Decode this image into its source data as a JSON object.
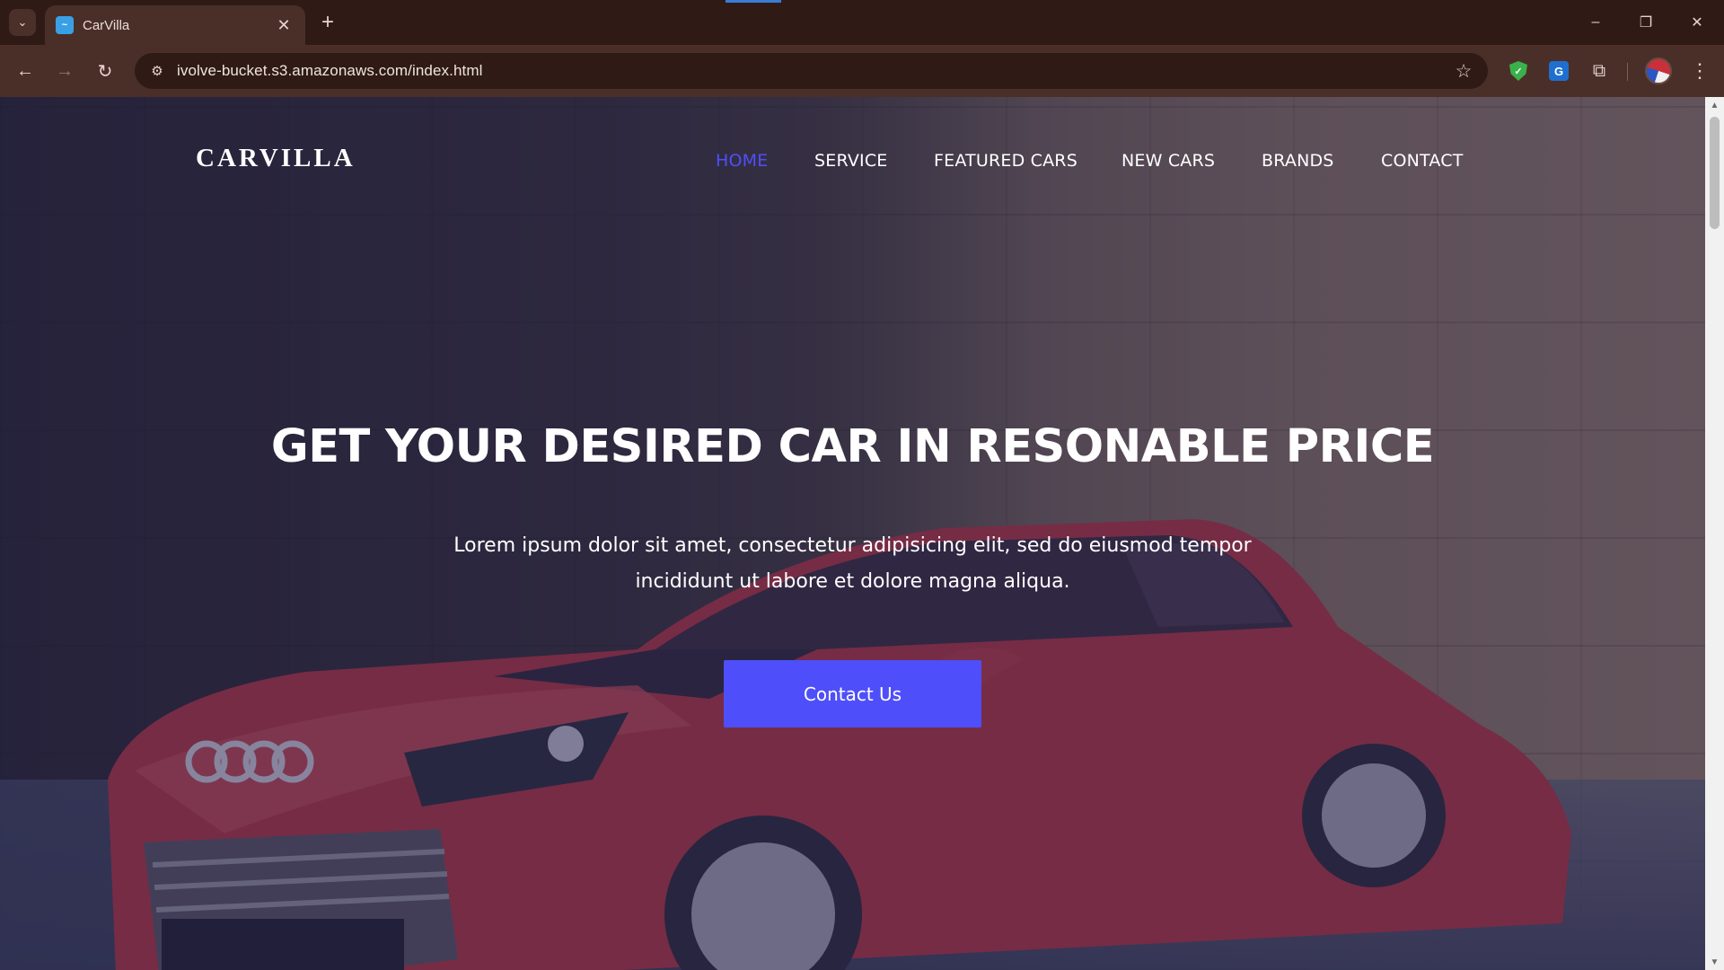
{
  "browser": {
    "tab_title": "CarVilla",
    "tab_favicon_letter": "~",
    "url": "ivolve-bucket.s3.amazonaws.com/index.html",
    "accent": "#3a7bd5"
  },
  "site": {
    "logo": "CARVILLA",
    "nav": [
      "HOME",
      "SERVICE",
      "FEATURED CARS",
      "NEW CARS",
      "BRANDS",
      "CONTACT"
    ],
    "active_nav": "HOME",
    "headline": "GET YOUR DESIRED CAR IN RESONABLE PRICE",
    "subtext_line1": "Lorem ipsum dolor sit amet, consectetur adipisicing elit, sed do eiusmod tempor",
    "subtext_line2": "incididunt ut labore et dolore magna aliqua.",
    "cta": "Contact Us",
    "accent": "#4e4ffa"
  },
  "icons": {
    "tab_search": "chevron-down-icon",
    "back": "arrow-left-icon",
    "forward": "arrow-right-icon",
    "reload": "reload-icon",
    "site_info": "tune-icon",
    "bookmark": "star-icon",
    "ext1": "shield-check-icon",
    "ext2": "translate-icon",
    "extensions": "puzzle-icon",
    "menu": "more-vertical-icon"
  }
}
